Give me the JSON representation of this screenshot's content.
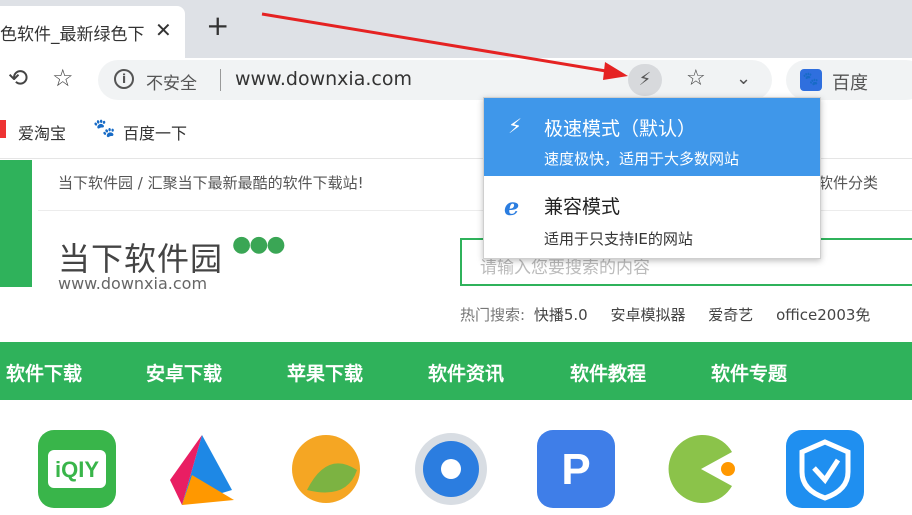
{
  "tab": {
    "title": "色软件_最新绿色下",
    "close": "✕",
    "new": "+"
  },
  "toolbar": {
    "reload_icon": "⟲",
    "star_icon": "☆",
    "info_icon": "i",
    "insecure_label": "不安全",
    "url": "www.downxia.com",
    "lightning_icon": "⚡",
    "omni_star_icon": "☆",
    "chevron_icon": "⌄",
    "search_engine": "百度"
  },
  "bookmarks": [
    {
      "label": "爱淘宝"
    },
    {
      "label": "百度一下"
    }
  ],
  "page": {
    "notice": "当下软件园 / 汇聚当下最新最酷的软件下载站!",
    "top_right": "软件分类",
    "logo_text": "当下软件园",
    "logo_dots": "●●●",
    "logo_url": "www.downxia.com",
    "search_placeholder": "请输入您要搜索的内容",
    "hot_label": "热门搜索:",
    "hot_items": [
      "快播5.0",
      "安卓模拟器",
      "爱奇艺",
      "office2003免"
    ],
    "nav": [
      "软件下载",
      "安卓下载",
      "苹果下载",
      "软件资讯",
      "软件教程",
      "软件专题"
    ]
  },
  "dropdown": {
    "option1": {
      "title": "极速模式（默认）",
      "desc": "速度极快，适用于大多数网站"
    },
    "option2": {
      "title": "兼容模式",
      "desc": "适用于只支持IE的网站",
      "icon": "e"
    }
  },
  "colors": {
    "accent": "#2fb25b",
    "highlight": "#3f97ea",
    "arrow": "#e52222"
  }
}
